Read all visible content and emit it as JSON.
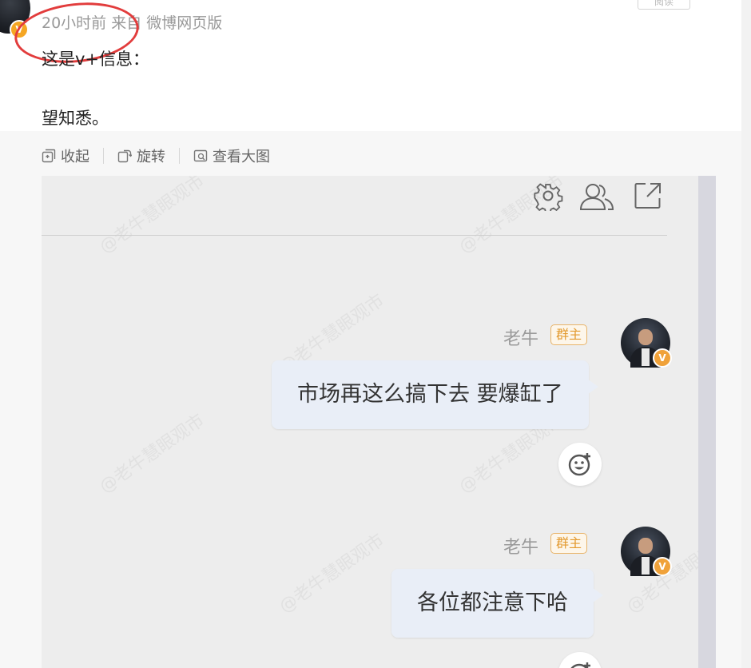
{
  "post": {
    "time": "20小时前",
    "source_prefix": "来自",
    "source": "微博网页版",
    "follow_label": "阅读",
    "verify_badge": "V",
    "line1": "这是v+信息：",
    "line2": "望知悉。"
  },
  "toolbar": {
    "collapse": "收起",
    "rotate": "旋转",
    "view_large": "查看大图"
  },
  "chat": {
    "messages": [
      {
        "sender": "老牛",
        "role": "群主",
        "text": "市场再这么搞下去 要爆缸了"
      },
      {
        "sender": "老牛",
        "role": "群主",
        "text": "各位都注意下哈"
      }
    ],
    "watermark": "@老牛慧眼观市"
  },
  "colors": {
    "accent_orange": "#f0a23a",
    "bubble": "#e9eef7",
    "annotation_red": "#e23c3c"
  },
  "icons": [
    "settings-icon",
    "group-members-icon",
    "share-out-icon",
    "collapse-icon",
    "rotate-icon",
    "view-large-icon",
    "add-reaction-icon"
  ]
}
